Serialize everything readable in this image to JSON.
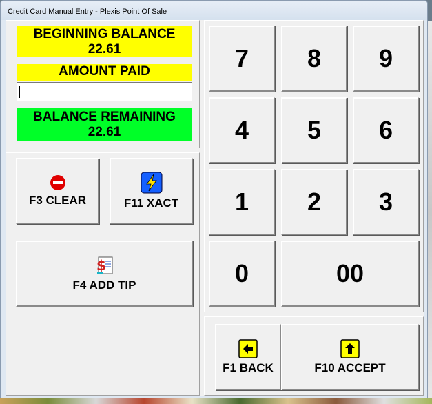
{
  "window": {
    "title": "Credit Card Manual Entry - Plexis Point Of Sale"
  },
  "balances": {
    "beginning_label": "BEGINNING BALANCE",
    "beginning_value": "22.61",
    "amount_paid_label": "AMOUNT PAID",
    "amount_paid_value": "",
    "remaining_label": "BALANCE REMAINING",
    "remaining_value": "22.61"
  },
  "actions": {
    "clear": {
      "label": "F3 CLEAR",
      "icon": "no-entry-icon"
    },
    "exact": {
      "label": "F11 XACT",
      "icon": "lightning-icon"
    },
    "tip": {
      "label": "F4 ADD TIP",
      "icon": "receipt-dollar-icon"
    }
  },
  "keypad": {
    "keys": [
      "7",
      "8",
      "9",
      "4",
      "5",
      "6",
      "1",
      "2",
      "3",
      "0",
      "00"
    ]
  },
  "nav": {
    "back": {
      "label": "F1 BACK",
      "icon": "arrow-left-icon"
    },
    "accept": {
      "label": "F10 ACCEPT",
      "icon": "arrow-up-icon"
    }
  },
  "colors": {
    "yellow": "#ffff00",
    "green": "#00ff28",
    "arrow_bg": "#ffff00",
    "lightning_bg": "#1560ff",
    "clear_red": "#e00000"
  }
}
